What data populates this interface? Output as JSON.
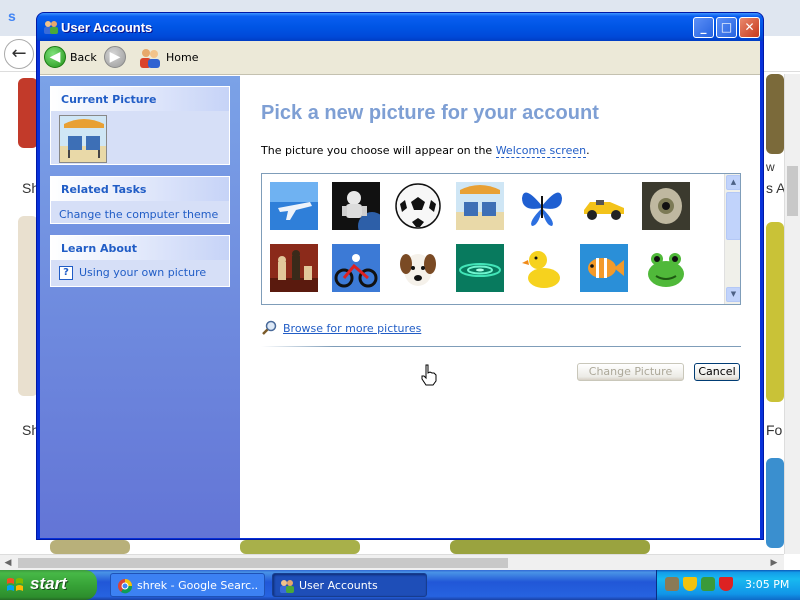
{
  "browser": {
    "tab_title": "s",
    "back_glyph": "←",
    "left_texts": [
      "Sh",
      "Sh"
    ],
    "right_texts": [
      "w",
      "s A",
      "Fo"
    ]
  },
  "window": {
    "title": "User Accounts",
    "minimize_glyph": "_",
    "maximize_glyph": "□",
    "close_glyph": "✕"
  },
  "toolbar": {
    "back_label": "Back",
    "home_label": "Home"
  },
  "task_pane": {
    "current_picture_heading": "Current Picture",
    "related_tasks_heading": "Related Tasks",
    "related_tasks": [
      "Change the computer theme"
    ],
    "learn_about_heading": "Learn About",
    "learn_about": [
      "Using your own picture"
    ]
  },
  "main": {
    "title": "Pick a new picture for your account",
    "intro_prefix": "The picture you choose will appear on the ",
    "intro_link": "Welcome screen",
    "intro_suffix": ".",
    "pictures": [
      {
        "name": "airplane",
        "color": "#2f7fd9"
      },
      {
        "name": "astronaut",
        "color": "#1a1a1a"
      },
      {
        "name": "soccer ball",
        "color": "#ffffff"
      },
      {
        "name": "beach chairs",
        "color": "#e8b04a"
      },
      {
        "name": "butterfly",
        "color": "#1f5fd1"
      },
      {
        "name": "car",
        "color": "#f3c31a"
      },
      {
        "name": "eye",
        "color": "#4b4b3a"
      },
      {
        "name": "chess",
        "color": "#8b2a1a"
      },
      {
        "name": "motorcycle",
        "color": "#3c7ad6"
      },
      {
        "name": "dog",
        "color": "#f5f1ea"
      },
      {
        "name": "drip",
        "color": "#0fb38e"
      },
      {
        "name": "duck",
        "color": "#f6d21e"
      },
      {
        "name": "fish",
        "color": "#2a8fd8"
      },
      {
        "name": "frog",
        "color": "#50b93a"
      }
    ],
    "browse_link": "Browse for more pictures",
    "change_button": "Change Picture",
    "cancel_button": "Cancel"
  },
  "taskbar": {
    "start_label": "start",
    "tasks": [
      "shrek - Google Searc...",
      "User Accounts"
    ],
    "clock": "3:05 PM"
  }
}
